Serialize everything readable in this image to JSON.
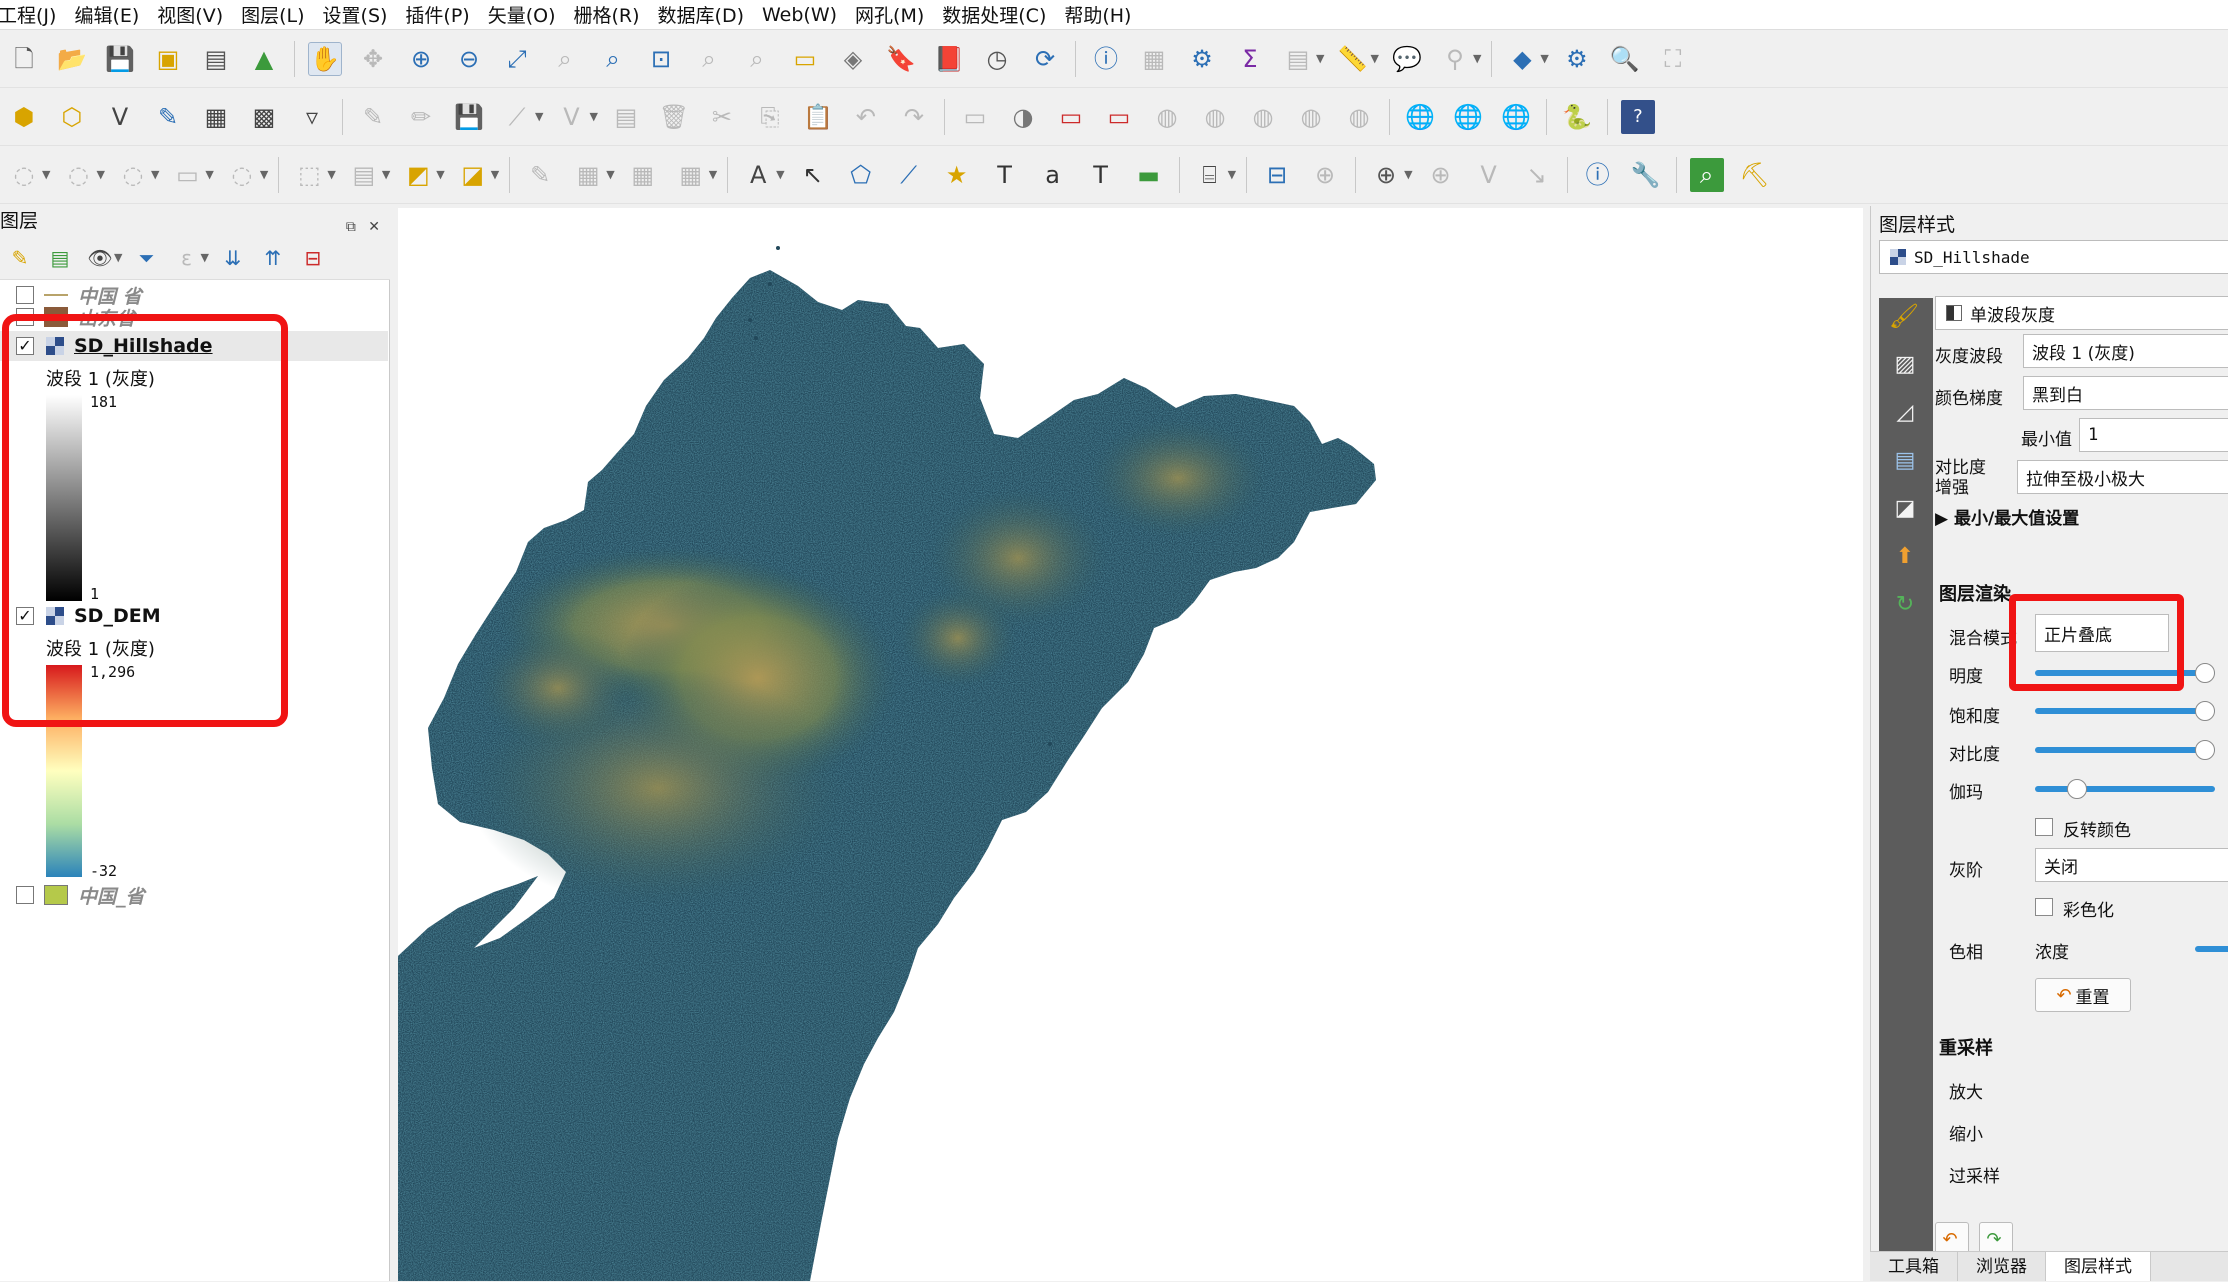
{
  "menu": [
    "工程(J)",
    "编辑(E)",
    "视图(V)",
    "图层(L)",
    "设置(S)",
    "插件(P)",
    "矢量(O)",
    "栅格(R)",
    "数据库(D)",
    "Web(W)",
    "网孔(M)",
    "数据处理(C)",
    "帮助(H)"
  ],
  "layers_panel": {
    "title": "图层",
    "items": {
      "china_province_top": "中国 省",
      "shandong": "山东省",
      "hillshade": "SD_Hillshade",
      "dem": "SD_DEM",
      "china_province_bottom": "中国_省"
    },
    "hillshade_band": "波段 1 (灰度)",
    "hillshade_max": "181",
    "hillshade_min": "1",
    "dem_band": "波段 1 (灰度)",
    "dem_max": "1,296",
    "dem_min": "-32"
  },
  "style_panel": {
    "title": "图层样式",
    "layer": "SD_Hillshade",
    "renderer": "单波段灰度",
    "gray_band_label": "灰度波段",
    "gray_band_value": "波段 1 (灰度)",
    "color_gradient_label": "颜色梯度",
    "color_gradient_value": "黑到白",
    "min_label": "最小值",
    "min_value": "1",
    "contrast_label": "对比度\n增强",
    "contrast_value": "拉伸至极小极大",
    "minmax_settings": "最小/最大值设置",
    "layer_rendering": "图层渲染",
    "blend_label": "混合模式",
    "blend_value": "正片叠底",
    "brightness": "明度",
    "saturation": "饱和度",
    "contrast": "对比度",
    "gamma": "伽玛",
    "invert": "反转颜色",
    "grayscale_label": "灰阶",
    "grayscale_value": "关闭",
    "hue_label": "色相",
    "colorize": "彩色化",
    "strength": "浓度",
    "reset": "重置",
    "resampling": "重采样",
    "zoom_in": "放大",
    "zoom_out": "缩小",
    "oversampling": "过采样",
    "slider_levels": {
      "brightness": 1.0,
      "saturation": 1.0,
      "contrast": 1.0,
      "gamma": 0.2
    }
  },
  "bottom_tabs": [
    "工具箱",
    "浏览器",
    "图层样式"
  ],
  "colors": {
    "accent": "#2f8fd6",
    "highlight": "#f01414"
  }
}
